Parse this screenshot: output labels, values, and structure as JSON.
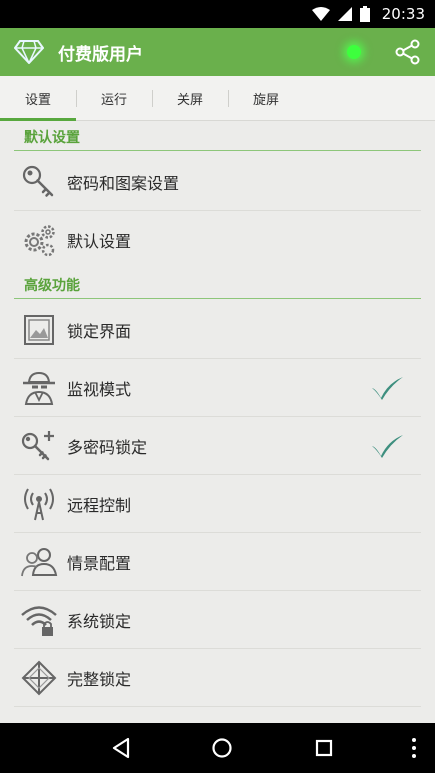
{
  "status_bar": {
    "time": "20:33"
  },
  "app_bar": {
    "title": "付费版用户"
  },
  "tabs": [
    {
      "label": "设置",
      "active": true
    },
    {
      "label": "运行",
      "active": false
    },
    {
      "label": "关屏",
      "active": false
    },
    {
      "label": "旋屏",
      "active": false
    }
  ],
  "sections": {
    "default": {
      "title": "默认设置",
      "items": [
        {
          "label": "密码和图案设置",
          "icon": "key-icon"
        },
        {
          "label": "默认设置",
          "icon": "gears-icon"
        }
      ]
    },
    "advanced": {
      "title": "高级功能",
      "items": [
        {
          "label": "锁定界面",
          "icon": "picture-icon",
          "checked": false
        },
        {
          "label": "监视模式",
          "icon": "spy-icon",
          "checked": true
        },
        {
          "label": "多密码锁定",
          "icon": "key-plus-icon",
          "checked": true
        },
        {
          "label": "远程控制",
          "icon": "antenna-icon",
          "checked": false
        },
        {
          "label": "情景配置",
          "icon": "users-icon",
          "checked": false
        },
        {
          "label": "系统锁定",
          "icon": "wifi-lock-icon",
          "checked": false
        },
        {
          "label": "完整锁定",
          "icon": "cross-diamond-icon",
          "checked": false
        }
      ]
    }
  },
  "colors": {
    "accent": "#6ab04c",
    "section": "#5aa33c",
    "check": "#3e8f7f"
  }
}
